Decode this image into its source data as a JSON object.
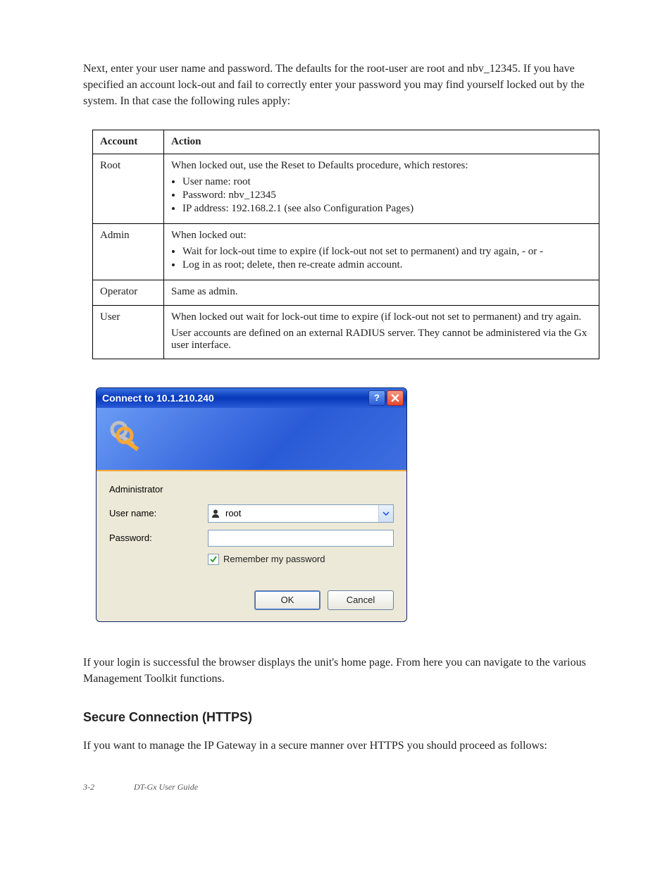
{
  "intro": "Next, enter your user name and password. The defaults for the root-user are root and nbv_12345. If you have specified an account lock-out and fail to correctly enter your password you may find yourself locked out by the system. In that case the following rules apply:",
  "table": {
    "header_left": "Account",
    "header_right": "Action",
    "rows": [
      {
        "left": "Root",
        "intro": "When locked out, use the Reset to Defaults procedure, which restores:",
        "bullets": [
          "User name: root",
          "Password: nbv_12345",
          "IP address: 192.168.2.1 (see also Configuration Pages)"
        ]
      },
      {
        "left": "Admin",
        "intro": "When locked out:",
        "bullets": [
          "Wait for lock-out time to expire (if lock-out not set to permanent) and try again, - or -",
          "Log in as root; delete, then re-create admin account."
        ]
      },
      {
        "left": "Operator",
        "right": "Same as admin."
      },
      {
        "left": "User",
        "intro": "When locked out wait for lock-out time to expire (if lock-out not set to permanent) and try again.",
        "intro2": "User accounts are defined on an external RADIUS server. They cannot be administered via the Gx user interface."
      }
    ]
  },
  "dialog": {
    "title": "Connect to 10.1.210.240",
    "role": "Administrator",
    "username_label": "User name:",
    "username_value": "root",
    "password_label": "Password:",
    "password_value": "",
    "remember_label": "Remember my password",
    "ok": "OK",
    "cancel": "Cancel"
  },
  "after": {
    "p1": "If your login is successful the browser displays the unit's home page. From here you can navigate to the various Management Toolkit functions.",
    "heading": "Secure Connection (HTTPS)",
    "p2": "If you want to manage the IP Gateway in a secure manner over HTTPS you should proceed as follows:"
  },
  "footer": {
    "page": "3-2",
    "text": "DT-Gx User Guide"
  }
}
